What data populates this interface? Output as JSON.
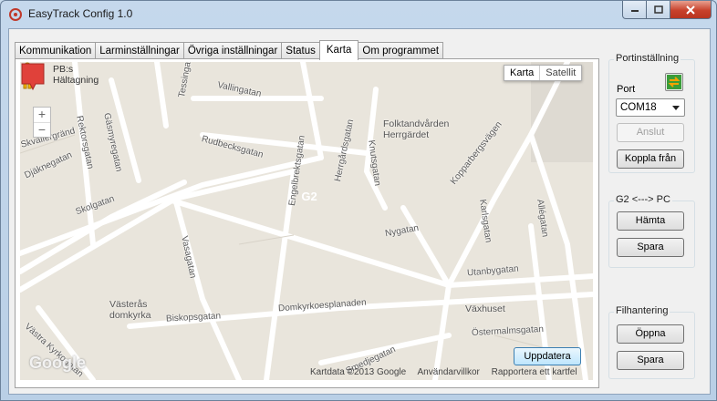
{
  "window": {
    "title": "EasyTrack Config 1.0"
  },
  "tabs": [
    {
      "label": "Kommunikation"
    },
    {
      "label": "Larminställningar"
    },
    {
      "label": "Övriga inställningar"
    },
    {
      "label": "Status"
    },
    {
      "label": "Karta"
    },
    {
      "label": "Om programmet"
    }
  ],
  "map": {
    "type_buttons": {
      "map": "Karta",
      "satellite": "Satellit"
    },
    "street_view_label": "PB:s Hältagning",
    "marker_label": "G2",
    "update_button": "Uppdatera",
    "logo": "Google",
    "copyright": "Kartdata ©2013 Google",
    "terms": "Användarvillkor",
    "report": "Rapportera ett kartfel",
    "streets": [
      "Vallingatan",
      "Tessingatan",
      "Rudbecksgatan",
      "Herrgårdsgatan",
      "Engelbrektsgatan",
      "Skolgatan",
      "Nygatan",
      "Vasagatan",
      "Djäknegatan",
      "Rektorsgatan",
      "Gäsmyregatan",
      "Kopparbergsvägen",
      "Knutsgatan",
      "Karlsgatan",
      "Allégatan",
      "Utanbygatan",
      "Domkyrkoesplanaden",
      "Biskopsgatan",
      "Smedjegatan",
      "Östermalmsgatan",
      "Västra Kyrkogatan",
      "Skvallergränd"
    ],
    "places": [
      {
        "name": "Folktandvården Herrgärdet"
      },
      {
        "name": "Västerås domkyrka"
      },
      {
        "name": "Växhuset"
      }
    ]
  },
  "sidebar": {
    "port_settings": {
      "title": "Portinställning",
      "port_label": "Port",
      "port_value": "COM18",
      "connect_button": "Anslut",
      "disconnect_button": "Koppla från"
    },
    "g2_pc": {
      "title": "G2 <---> PC",
      "fetch_button": "Hämta",
      "save_button": "Spara"
    },
    "file_handling": {
      "title": "Filhantering",
      "open_button": "Öppna",
      "save_button": "Spara"
    }
  },
  "colors": {
    "accent": "#3c7fb1",
    "marker": "#e0413a",
    "map_bg": "#e9e5dc",
    "road": "#ffffff"
  }
}
